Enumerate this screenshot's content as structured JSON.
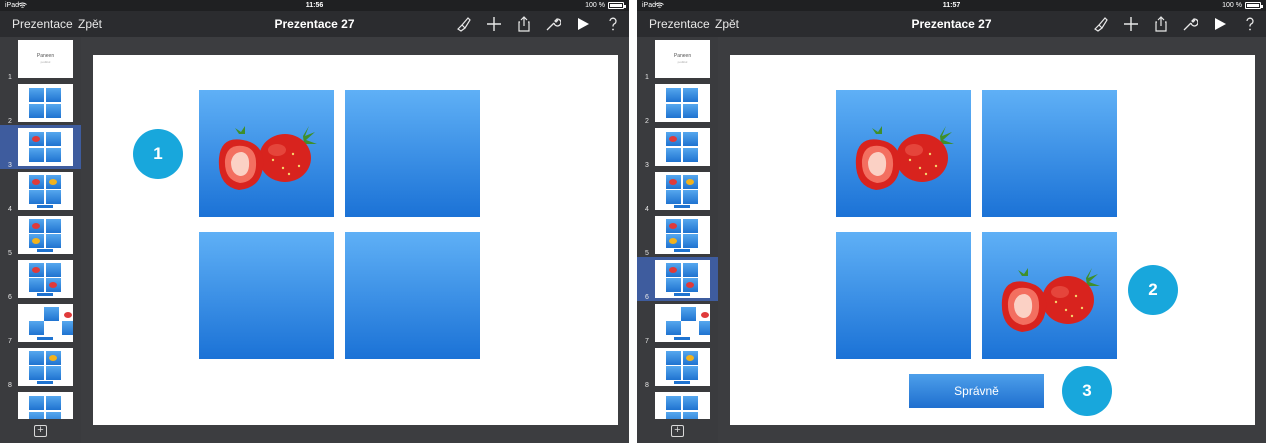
{
  "screens": [
    {
      "status": {
        "carrier": "iPad",
        "time": "11:56",
        "battery": "100 %"
      },
      "toolbar": {
        "presentations": "Prezentace",
        "back": "Zpět",
        "title": "Prezentace 27"
      },
      "selected_slide": 3,
      "slide_numbers": [
        "1",
        "2",
        "3",
        "4",
        "5",
        "6",
        "7",
        "8"
      ],
      "callouts": [
        {
          "label": "1"
        }
      ]
    },
    {
      "status": {
        "carrier": "iPad",
        "time": "11:57",
        "battery": "100 %"
      },
      "toolbar": {
        "presentations": "Prezentace",
        "back": "Zpět",
        "title": "Prezentace 27"
      },
      "selected_slide": 6,
      "slide_numbers": [
        "1",
        "2",
        "3",
        "4",
        "5",
        "6",
        "7",
        "8"
      ],
      "answer_button": "Správně",
      "callouts": [
        {
          "label": "2"
        },
        {
          "label": "3"
        }
      ]
    }
  ],
  "thumbnail_title": "Paneen",
  "thumbnail_subtitle": "podtitul",
  "icons": [
    "wifi-icon",
    "battery-icon",
    "paintbrush-icon",
    "plus-icon",
    "share-icon",
    "wrench-icon",
    "play-icon",
    "help-icon",
    "add-slide-icon",
    "strawberry-icon"
  ],
  "colors": {
    "accent": "#18a7dc",
    "tile_top": "#5fb0f6",
    "tile_bottom": "#1b72d6",
    "selection": "#3e5c9e",
    "toolbar": "#2b2c2f"
  }
}
